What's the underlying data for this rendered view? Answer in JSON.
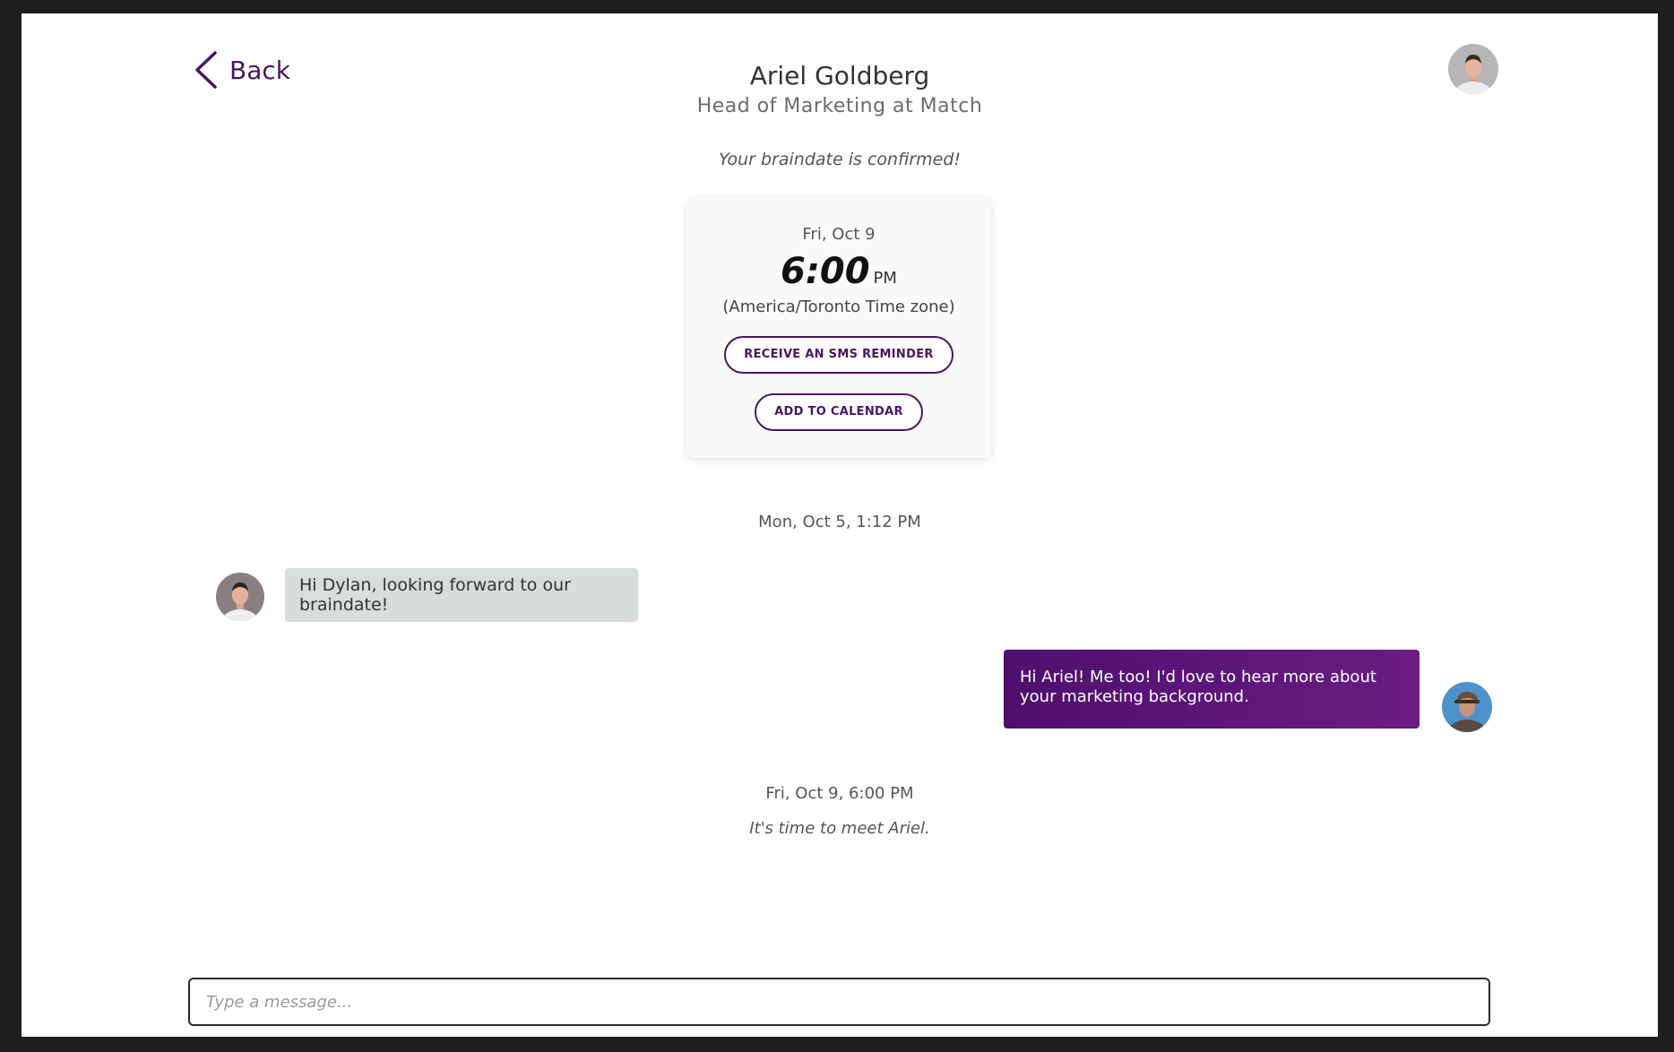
{
  "header": {
    "back_label": "Back",
    "name": "Ariel Goldberg",
    "subtitle": "Head of Marketing at Match"
  },
  "confirmation": {
    "text": "Your braindate is confirmed!",
    "date": "Fri, Oct 9",
    "time": "6:00",
    "ampm": "PM",
    "timezone": "(America/Toronto Time zone)",
    "sms_button": "RECEIVE AN SMS REMINDER",
    "calendar_button": "ADD TO CALENDAR"
  },
  "thread": {
    "timestamp_1": "Mon, Oct 5, 1:12 PM",
    "incoming_message": "Hi Dylan, looking forward to our braindate!",
    "outgoing_message": "Hi Ariel! Me too! I'd love to hear more about your marketing background.",
    "timestamp_2": "Fri, Oct 9, 6:00 PM",
    "meet_text": "It's time to meet Ariel."
  },
  "composer": {
    "placeholder": "Type a message..."
  },
  "colors": {
    "accent": "#4a1560",
    "outgoing_bubble": "#5a1477",
    "incoming_bubble": "#d8dcdc",
    "background": "#ffffff",
    "outer_frame": "#1e1e1e"
  },
  "icons": {
    "back": "chevron-left-icon"
  }
}
